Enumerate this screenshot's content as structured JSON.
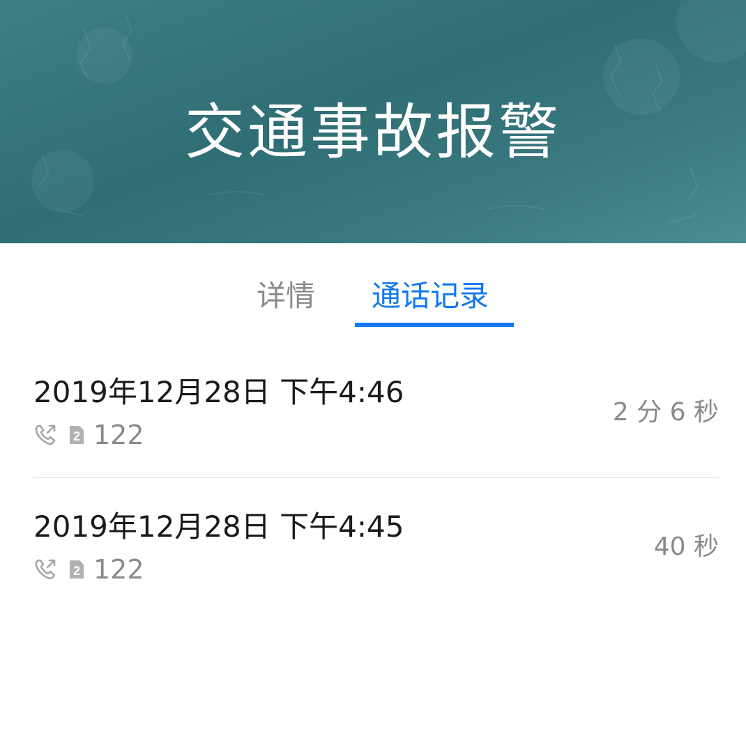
{
  "header": {
    "title": "交通事故报警",
    "background_color": "#3a7a80"
  },
  "tabs": [
    {
      "label": "详情",
      "active": false
    },
    {
      "label": "通话记录",
      "active": true
    }
  ],
  "accent_color": "#1279ee",
  "call_log": [
    {
      "time": "2019年12月28日 下午4:46",
      "icon": "outgoing-call-icon",
      "sim": "2",
      "number": "122",
      "duration": "2 分 6 秒"
    },
    {
      "time": "2019年12月28日 下午4:45",
      "icon": "outgoing-call-icon",
      "sim": "2",
      "number": "122",
      "duration": "40 秒"
    }
  ]
}
